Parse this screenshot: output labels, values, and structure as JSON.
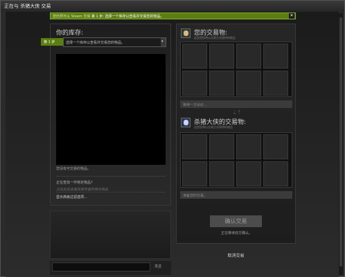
{
  "window": {
    "title": "正在与 杀猪大侠 交易"
  },
  "notice": {
    "prefix": "您仍然可以 Steam 交易",
    "text": "第 1 步: 选择一个库存以查看并交易您的物品。"
  },
  "inventory": {
    "title": "你的库存:",
    "step_badge": "第 1 步",
    "select_placeholder": "选择一个库存以查看并交易您的物品。",
    "status": "您没有可交易的物品。",
    "hint": "正在查找一件特定物品?",
    "hint_sub": "点击此处查看其库存里的相关物品",
    "advanced_link": "显示高级过滤选项..."
  },
  "chat": {
    "send_label": "发送"
  },
  "your_offer": {
    "title": "您的交易物:",
    "subtitle": "这里是您将以交易方式提供的物品",
    "status": "等待一方出价..."
  },
  "their_offer": {
    "title": "杀猪大侠的交易物:",
    "subtitle": "这是您将以交易方式获得的物品",
    "status": "准备您的交易。"
  },
  "actions": {
    "confirm_label": "确认交易",
    "confirm_status": "正在等待双方确认。",
    "cancel_label": "取消交易"
  },
  "colors": {
    "accent_green": "#5c7e10",
    "background": "#1b1b1b"
  }
}
